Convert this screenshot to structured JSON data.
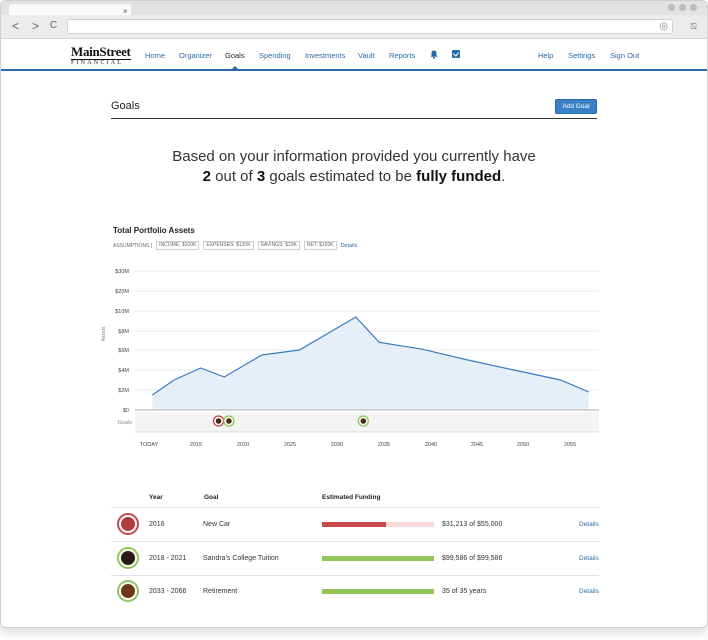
{
  "browser": {
    "tab_close": "×",
    "back": "<",
    "forward": ">",
    "reload": "C"
  },
  "header": {
    "logo_main": "MainStreet",
    "logo_sub": "FINANCIAL",
    "nav": [
      "Home",
      "Organizer",
      "Goals",
      "Spending",
      "Investments",
      "Vault",
      "Reports"
    ],
    "active_nav": "Goals",
    "right_nav": [
      "Help",
      "Settings",
      "Sign Out"
    ]
  },
  "page": {
    "title": "Goals",
    "add_goal_label": "Add Goal",
    "headline_pre": "Based on your information provided you currently have",
    "headline_count": "2",
    "headline_mid": " out of ",
    "headline_total": "3",
    "headline_mid2": " goals estimated to be ",
    "headline_bold": "fully funded",
    "headline_end": "."
  },
  "assumptions": {
    "label": "ASSUMPTIONS |",
    "items": [
      "INCOME: $100K",
      "EXPENSES: $120K",
      "SAVINGS: $20K",
      "NET: $100K"
    ],
    "details": "Details"
  },
  "chart_data": {
    "type": "area",
    "title": "Total Portfolio Assets",
    "ylabel": "Assets",
    "y_ticks": [
      "$0",
      "$2M",
      "$4M",
      "$6M",
      "$8M",
      "$10M",
      "$20M",
      "$30M"
    ],
    "x_ticks": [
      "TODAY",
      "2015",
      "2020",
      "2025",
      "2030",
      "2035",
      "2040",
      "2045",
      "2050",
      "2055"
    ],
    "goals_row_label": "Goals",
    "series": [
      {
        "x": [
          2011,
          2013,
          2015.5,
          2018,
          2022,
          2026,
          2032,
          2034.5,
          2039,
          2044,
          2049,
          2054,
          2057
        ],
        "values": [
          1.5,
          3.0,
          4.2,
          3.3,
          5.5,
          6.0,
          9.4,
          6.8,
          6.1,
          5.0,
          4.0,
          3.0,
          1.8
        ]
      }
    ],
    "goal_markers": [
      {
        "x": 2017.4,
        "color": "#c44444"
      },
      {
        "x": 2018.5,
        "color": "#8cc04f"
      },
      {
        "x": 2032.8,
        "color": "#8cc04f"
      }
    ],
    "colors": {
      "line": "#3a7cc0",
      "fill": "#e6eff8",
      "grid": "#e3e3e3"
    }
  },
  "table": {
    "headers": {
      "year": "Year",
      "goal": "Goal",
      "funding": "Estimated Funding"
    },
    "rows": [
      {
        "year": "2016",
        "goal": "New Car",
        "funded": 0.57,
        "color": "#c84a4a",
        "amount": "$31,213 of $55,000",
        "details": "Details",
        "ring": "#c84a4a",
        "icon": "car-icon"
      },
      {
        "year": "2018 -  2021",
        "goal": "Sandra's College Tuition",
        "funded": 1.0,
        "color": "#92c65a",
        "amount": "$99,586 of $99,586",
        "details": "Details",
        "ring": "#92c65a",
        "icon": "graduation-icon"
      },
      {
        "year": "2033 -  2066",
        "goal": "Retirement",
        "funded": 1.0,
        "color": "#92c65a",
        "amount": "35 of 35 years",
        "details": "Details",
        "ring": "#92c65a",
        "icon": "retirement-icon"
      }
    ]
  }
}
